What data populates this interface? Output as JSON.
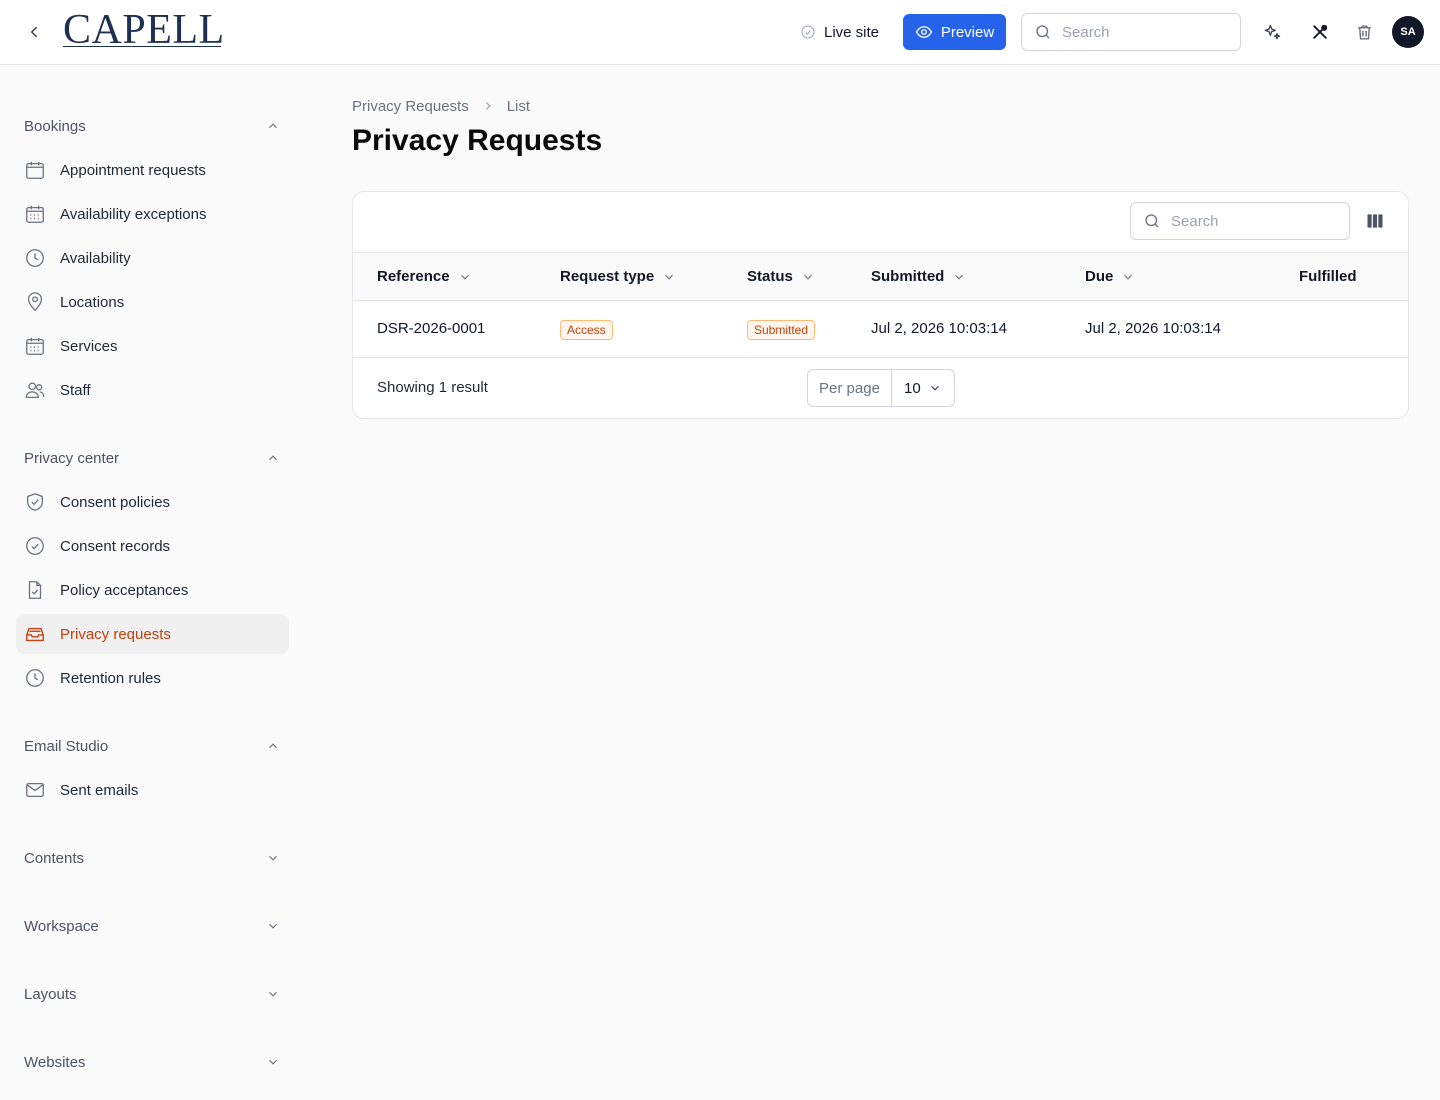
{
  "header": {
    "logo_text": "CAPELL",
    "live_site_label": "Live site",
    "preview_label": "Preview",
    "search_placeholder": "Search",
    "avatar_initials": "SA"
  },
  "sidebar": {
    "groups": [
      {
        "label": "Bookings",
        "expanded": true,
        "items": [
          {
            "label": "Appointment requests",
            "icon": "calendar-icon"
          },
          {
            "label": "Availability exceptions",
            "icon": "calendar-grid-icon"
          },
          {
            "label": "Availability",
            "icon": "clock-icon"
          },
          {
            "label": "Locations",
            "icon": "map-pin-icon"
          },
          {
            "label": "Services",
            "icon": "calendar-grid-icon"
          },
          {
            "label": "Staff",
            "icon": "users-icon"
          }
        ]
      },
      {
        "label": "Privacy center",
        "expanded": true,
        "items": [
          {
            "label": "Consent policies",
            "icon": "shield-check-icon"
          },
          {
            "label": "Consent records",
            "icon": "check-circle-icon"
          },
          {
            "label": "Policy acceptances",
            "icon": "document-check-icon"
          },
          {
            "label": "Privacy requests",
            "icon": "inbox-stack-icon",
            "active": true
          },
          {
            "label": "Retention rules",
            "icon": "clock-icon"
          }
        ]
      },
      {
        "label": "Email Studio",
        "expanded": true,
        "items": [
          {
            "label": "Sent emails",
            "icon": "envelope-icon"
          }
        ]
      },
      {
        "label": "Contents",
        "expanded": false,
        "items": []
      },
      {
        "label": "Workspace",
        "expanded": false,
        "items": []
      },
      {
        "label": "Layouts",
        "expanded": false,
        "items": []
      },
      {
        "label": "Websites",
        "expanded": false,
        "items": []
      }
    ]
  },
  "breadcrumb": {
    "parent": "Privacy Requests",
    "current": "List"
  },
  "page": {
    "title": "Privacy Requests"
  },
  "table": {
    "search_placeholder": "Search",
    "columns": [
      "Reference",
      "Request type",
      "Status",
      "Submitted",
      "Due",
      "Fulfilled"
    ],
    "rows": [
      {
        "reference": "DSR-2026-0001",
        "request_type": "Access",
        "status": "Submitted",
        "submitted": "Jul 2, 2026 10:03:14",
        "due": "Jul 2, 2026 10:03:14",
        "fulfilled": ""
      }
    ],
    "result_count": "Showing 1 result",
    "per_page_label": "Per page",
    "per_page_value": "10"
  },
  "colors": {
    "accent": "#2563eb",
    "active_nav": "#c2410c",
    "badge_bg": "#fff7ed",
    "badge_border": "#fdba74"
  }
}
